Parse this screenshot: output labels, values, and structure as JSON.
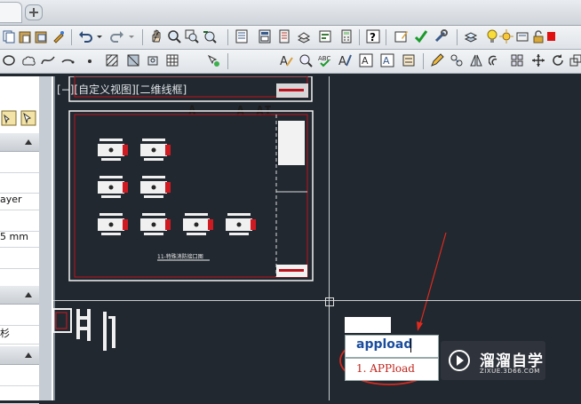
{
  "viewport_label": "[−][自定义视图][二维线框]",
  "palette": {
    "rows": [
      {
        "text": ""
      },
      {
        "text": ""
      },
      {
        "text": "ayer"
      },
      {
        "text": ""
      },
      {
        "text": "5 mm"
      },
      {
        "text": ""
      },
      {
        "text": ""
      },
      {
        "text": "杉"
      },
      {
        "text": ""
      },
      {
        "text": ""
      }
    ]
  },
  "drawing": {
    "sheet_caption": "11-特殊消防接口图"
  },
  "command": {
    "input": "appload",
    "suggestion": "1. APPload"
  },
  "toolbar2": {
    "text_icon": "A",
    "text_icon2": "AI"
  },
  "watermark": {
    "title": "溜溜自学",
    "subtitle": "ZIXUE.3D66.COM"
  },
  "colors": {
    "canvas": "#212830",
    "arrow": "#e02a1e",
    "highlight": "#d52a20"
  }
}
